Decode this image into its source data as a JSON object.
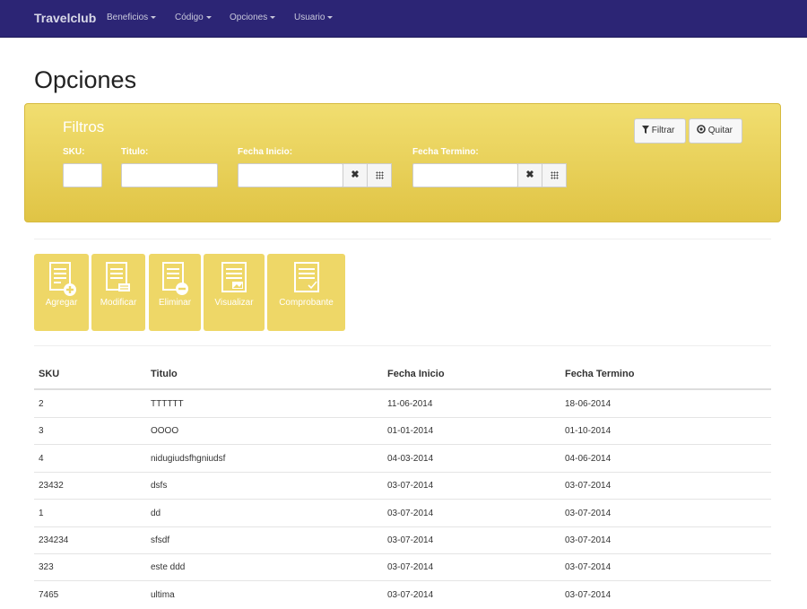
{
  "navbar": {
    "brand": "Travelclub",
    "items": [
      {
        "label": "Beneficios"
      },
      {
        "label": "Código"
      },
      {
        "label": "Opciones"
      },
      {
        "label": "Usuario"
      }
    ]
  },
  "page": {
    "title": "Opciones"
  },
  "filters": {
    "title": "Filtros",
    "sku_label": "SKU:",
    "titulo_label": "Titulo:",
    "fecha_inicio_label": "Fecha Inicio:",
    "fecha_termino_label": "Fecha Termino:",
    "sku_value": "",
    "titulo_value": "",
    "fecha_inicio_value": "",
    "fecha_termino_value": "",
    "clear_glyph": "✖",
    "filter_button": "Filtrar",
    "remove_button": "Quitar",
    "colors": {
      "panel": "#e8cf55",
      "text": "#ffffff"
    }
  },
  "actions": [
    {
      "label": "Agregar",
      "icon": "document-add-icon"
    },
    {
      "label": "Modificar",
      "icon": "document-edit-icon"
    },
    {
      "label": "Eliminar",
      "icon": "document-remove-icon"
    },
    {
      "label": "Visualizar",
      "icon": "document-view-icon"
    },
    {
      "label": "Comprobante",
      "icon": "document-check-icon"
    }
  ],
  "table": {
    "headers": [
      "SKU",
      "Titulo",
      "Fecha Inicio",
      "Fecha Termino"
    ],
    "rows": [
      [
        "2",
        "TTTTTT",
        "11-06-2014",
        "18-06-2014"
      ],
      [
        "3",
        "OOOO",
        "01-01-2014",
        "01-10-2014"
      ],
      [
        "4",
        "nidugiudsfhgniudsf",
        "04-03-2014",
        "04-06-2014"
      ],
      [
        "23432",
        "dsfs",
        "03-07-2014",
        "03-07-2014"
      ],
      [
        "1",
        "dd",
        "03-07-2014",
        "03-07-2014"
      ],
      [
        "234234",
        "sfsdf",
        "03-07-2014",
        "03-07-2014"
      ],
      [
        "323",
        "este ddd",
        "03-07-2014",
        "03-07-2014"
      ],
      [
        "7465",
        "ultima",
        "03-07-2014",
        "03-07-2014"
      ]
    ]
  },
  "colors": {
    "navbar": "#2c2575",
    "tile": "#eed767"
  }
}
